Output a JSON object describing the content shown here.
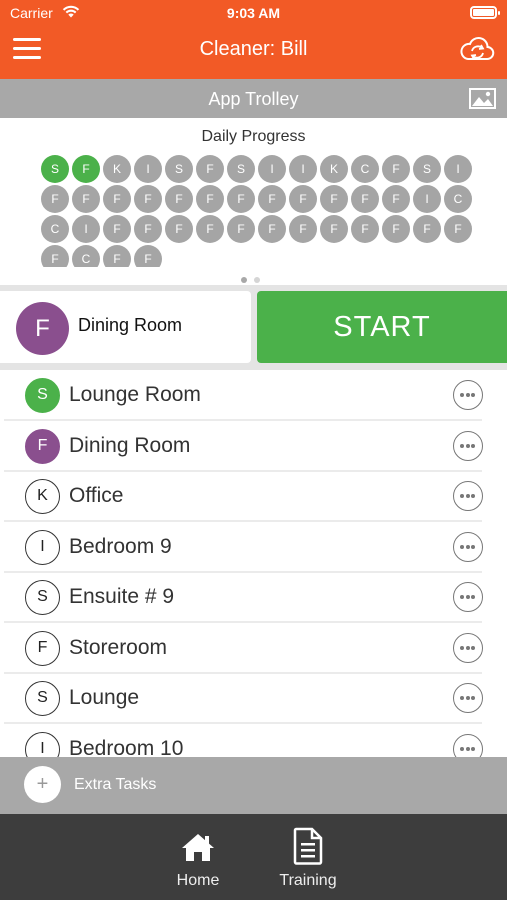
{
  "status_bar": {
    "carrier": "Carrier",
    "time": "9:03 AM"
  },
  "header": {
    "title": "Cleaner: Bill"
  },
  "trolley": {
    "title": "App Trolley"
  },
  "progress": {
    "title": "Daily Progress",
    "chips": [
      {
        "letter": "S",
        "done": true
      },
      {
        "letter": "F",
        "done": true
      },
      {
        "letter": "K",
        "done": false
      },
      {
        "letter": "I",
        "done": false
      },
      {
        "letter": "S",
        "done": false
      },
      {
        "letter": "F",
        "done": false
      },
      {
        "letter": "S",
        "done": false
      },
      {
        "letter": "I",
        "done": false
      },
      {
        "letter": "I",
        "done": false
      },
      {
        "letter": "K",
        "done": false
      },
      {
        "letter": "C",
        "done": false
      },
      {
        "letter": "F",
        "done": false
      },
      {
        "letter": "S",
        "done": false
      },
      {
        "letter": "I",
        "done": false
      },
      {
        "letter": "F",
        "done": false
      },
      {
        "letter": "F",
        "done": false
      },
      {
        "letter": "F",
        "done": false
      },
      {
        "letter": "F",
        "done": false
      },
      {
        "letter": "F",
        "done": false
      },
      {
        "letter": "F",
        "done": false
      },
      {
        "letter": "F",
        "done": false
      },
      {
        "letter": "F",
        "done": false
      },
      {
        "letter": "F",
        "done": false
      },
      {
        "letter": "F",
        "done": false
      },
      {
        "letter": "F",
        "done": false
      },
      {
        "letter": "F",
        "done": false
      },
      {
        "letter": "I",
        "done": false
      },
      {
        "letter": "C",
        "done": false
      },
      {
        "letter": "C",
        "done": false
      },
      {
        "letter": "I",
        "done": false
      },
      {
        "letter": "F",
        "done": false
      },
      {
        "letter": "F",
        "done": false
      },
      {
        "letter": "F",
        "done": false
      },
      {
        "letter": "F",
        "done": false
      },
      {
        "letter": "F",
        "done": false
      },
      {
        "letter": "F",
        "done": false
      },
      {
        "letter": "F",
        "done": false
      },
      {
        "letter": "F",
        "done": false
      },
      {
        "letter": "F",
        "done": false
      },
      {
        "letter": "F",
        "done": false
      },
      {
        "letter": "F",
        "done": false
      },
      {
        "letter": "F",
        "done": false
      },
      {
        "letter": "F",
        "done": false
      },
      {
        "letter": "C",
        "done": false
      },
      {
        "letter": "F",
        "done": false
      },
      {
        "letter": "F",
        "done": false
      }
    ],
    "page_count": 2,
    "active_page": 0
  },
  "current_task": {
    "badge": "F",
    "name": "Dining Room",
    "start_label": "START"
  },
  "rooms": [
    {
      "badge": "S",
      "name": "Lounge Room",
      "state": "done"
    },
    {
      "badge": "F",
      "name": "Dining Room",
      "state": "current"
    },
    {
      "badge": "K",
      "name": "Office",
      "state": "pending"
    },
    {
      "badge": "I",
      "name": "Bedroom 9",
      "state": "pending"
    },
    {
      "badge": "S",
      "name": "Ensuite # 9",
      "state": "pending"
    },
    {
      "badge": "F",
      "name": "Storeroom",
      "state": "pending"
    },
    {
      "badge": "S",
      "name": "Lounge",
      "state": "pending"
    },
    {
      "badge": "I",
      "name": "Bedroom 10",
      "state": "pending"
    }
  ],
  "extra_tasks": {
    "icon_glyph": "+",
    "label": "Extra Tasks"
  },
  "tabbar": {
    "home_label": "Home",
    "training_label": "Training"
  },
  "colors": {
    "brand_orange": "#f25a26",
    "done_green": "#4bb14a",
    "current_purple": "#8a4f8e",
    "pending_grey": "#a5a5a5",
    "tabbar_dark": "#3d3d3d"
  }
}
